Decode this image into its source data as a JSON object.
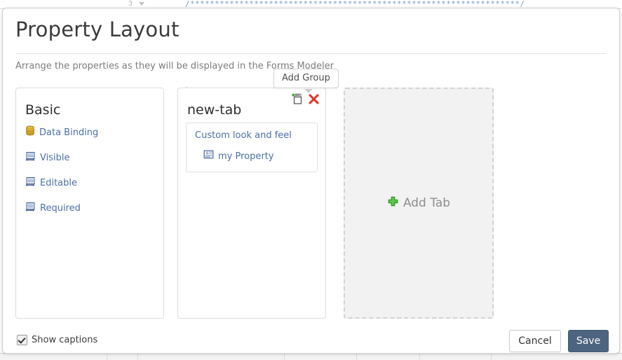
{
  "background": {
    "gutter_line_number": "3",
    "code_line": "/*******************************************************************/"
  },
  "dialog": {
    "title": "Property Layout",
    "subtitle": "Arrange the properties as they will be displayed in the Forms Modeler"
  },
  "tooltip": {
    "label": "Add Group"
  },
  "panels": [
    {
      "title": "Basic",
      "items": [
        {
          "label": "Data Binding",
          "icon": "database-icon"
        },
        {
          "label": "Visible",
          "icon": "form-field-icon"
        },
        {
          "label": "Editable",
          "icon": "form-field-icon"
        },
        {
          "label": "Required",
          "icon": "form-field-icon"
        }
      ]
    },
    {
      "title": "new-tab",
      "group": {
        "title": "Custom look and feel",
        "items": [
          {
            "label": "my Property",
            "icon": "text-field-icon"
          }
        ]
      },
      "actions": [
        {
          "name": "add-group-icon",
          "title": "Add Group"
        },
        {
          "name": "delete-tab-icon",
          "title": "Delete"
        }
      ]
    }
  ],
  "add_tab": {
    "label": "Add Tab",
    "icon": "green-plus-icon"
  },
  "footer": {
    "show_captions_label": "Show captions",
    "show_captions_checked": true,
    "cancel_label": "Cancel",
    "save_label": "Save"
  },
  "colors": {
    "save_button": "#4d6480",
    "property_text": "#4a6fa5",
    "add_plus_green": "#3ea82e",
    "delete_red": "#e03b2b",
    "dropzone_fill": "#f2f2f2",
    "dropzone_border": "#d3d3d3",
    "code_blue": "#7d9ec9"
  }
}
